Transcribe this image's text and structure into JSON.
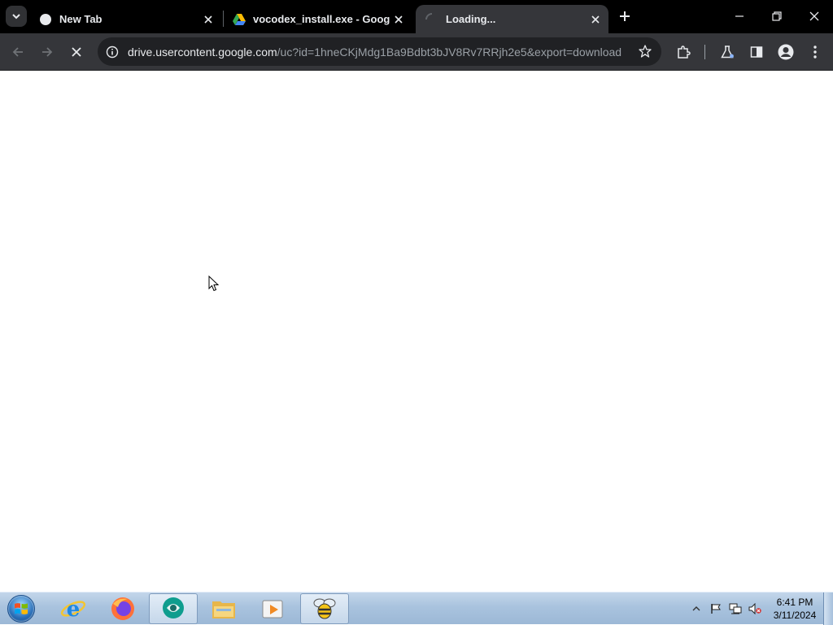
{
  "browser": {
    "tabs": [
      {
        "title": "New Tab",
        "icon": "chrome-blank-icon"
      },
      {
        "title": "vocodex_install.exe - Google D",
        "icon": "google-drive-icon"
      },
      {
        "title": "Loading...",
        "icon": "loading-spinner-icon"
      }
    ],
    "address_bar": {
      "host": "drive.usercontent.google.com",
      "path": "/uc?id=1hneCKjMdg1Ba9Bdbt3bJV8Rv7RRjh2e5&export=download"
    }
  },
  "taskbar": {
    "apps": [
      "internet-explorer-icon",
      "firefox-icon",
      "chrome-remote-icon",
      "file-explorer-icon",
      "media-player-icon",
      "bee-app-icon"
    ],
    "clock": {
      "time": "6:41 PM",
      "date": "3/11/2024"
    }
  },
  "colors": {
    "tabstrip": "#000000",
    "toolbar": "#35363a",
    "omnibox": "#202124",
    "taskbar": "#a9c3de"
  }
}
